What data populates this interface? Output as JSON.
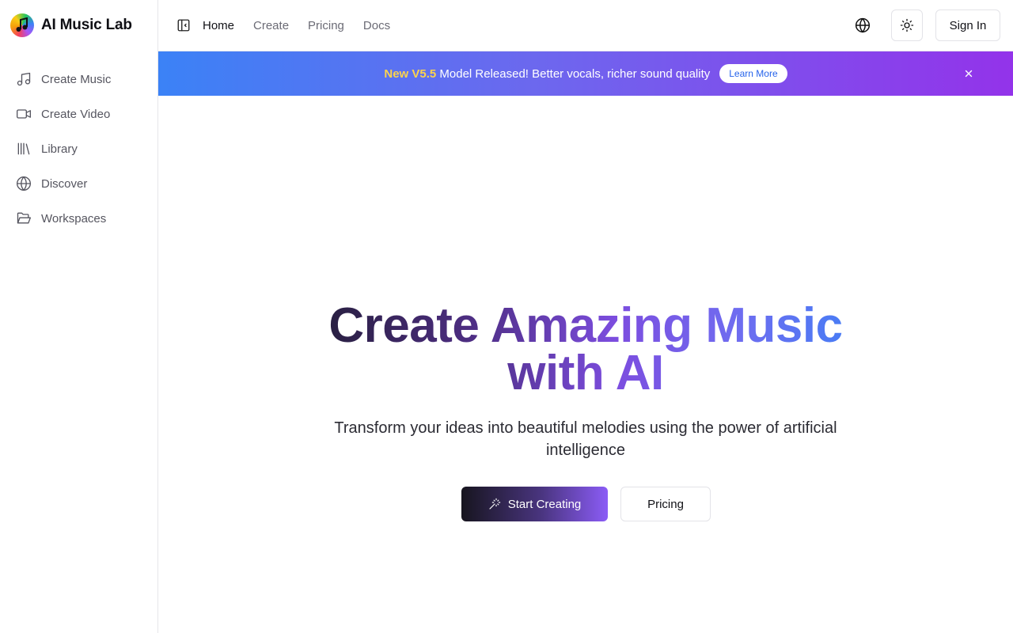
{
  "brand": {
    "name": "AI Music Lab",
    "logo_icon": "music-note-icon"
  },
  "sidebar": {
    "items": [
      {
        "label": "Create Music",
        "icon": "music-note-icon"
      },
      {
        "label": "Create Video",
        "icon": "video-camera-icon"
      },
      {
        "label": "Library",
        "icon": "library-icon"
      },
      {
        "label": "Discover",
        "icon": "globe-icon"
      },
      {
        "label": "Workspaces",
        "icon": "folder-open-icon"
      }
    ]
  },
  "header": {
    "nav": [
      {
        "label": "Home",
        "active": true
      },
      {
        "label": "Create",
        "active": false
      },
      {
        "label": "Pricing",
        "active": false
      },
      {
        "label": "Docs",
        "active": false
      }
    ],
    "sign_in_label": "Sign In"
  },
  "banner": {
    "highlight": "New V5.5",
    "text": " Model Released! Better vocals, richer sound quality",
    "cta_label": "Learn More",
    "gradient": [
      "#3b82f6",
      "#9333ea"
    ],
    "highlight_color": "#fcd34d"
  },
  "hero": {
    "title": "Create Amazing Music with AI",
    "subtitle": "Transform your ideas into beautiful melodies using the power of artificial intelligence",
    "primary_cta": "Start Creating",
    "secondary_cta": "Pricing"
  }
}
